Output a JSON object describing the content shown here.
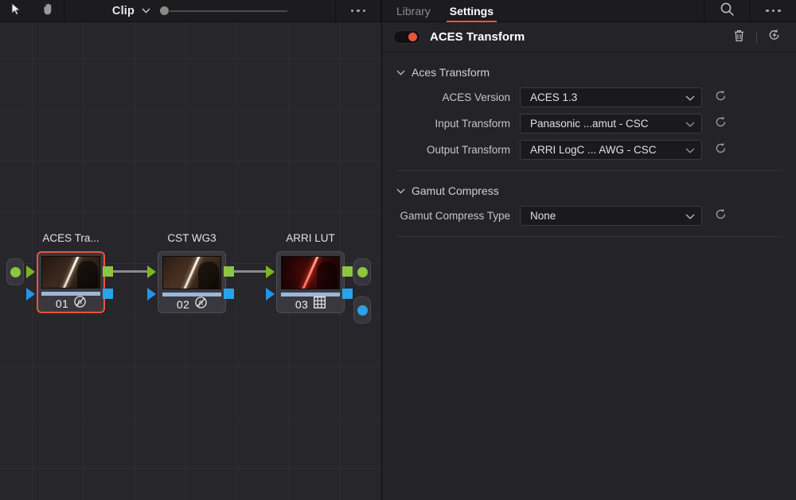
{
  "node_toolbar": {
    "tools": [
      {
        "name": "select-tool",
        "icon": "arrow-cursor-icon"
      },
      {
        "name": "pan-tool",
        "icon": "hand-icon"
      }
    ],
    "clip_label": "Clip",
    "chevron_icon": "chevron-down-icon",
    "slider_value": 0,
    "overflow_icon": "ellipsis-icon"
  },
  "node_graph": {
    "input_connector": {
      "name": "graph-input-source",
      "color": "#8cc63f"
    },
    "output_connectors": [
      {
        "name": "graph-output-rgb",
        "color": "#8cc63f"
      },
      {
        "name": "graph-output-key",
        "color": "#2aa3e8"
      }
    ],
    "nodes": [
      {
        "title": "ACES Tra...",
        "number": "01",
        "badge_icon": "fx-icon",
        "selected": true,
        "thumb_streak": "#d8c9b4",
        "thumb_bg": "#2a1d16"
      },
      {
        "title": "CST WG3",
        "number": "02",
        "badge_icon": "fx-icon",
        "selected": false,
        "thumb_streak": "#e7d7bf",
        "thumb_bg": "#32201a"
      },
      {
        "title": "ARRI LUT",
        "number": "03",
        "badge_icon": "lut-grid-icon",
        "selected": false,
        "thumb_streak": "#ff6a58",
        "thumb_bg": "#2e0707"
      }
    ]
  },
  "inspector": {
    "tabs": [
      {
        "label": "Library",
        "active": false
      },
      {
        "label": "Settings",
        "active": true
      }
    ],
    "search_icon": "search-icon",
    "overflow_icon": "ellipsis-icon",
    "effect": {
      "enabled": true,
      "accent_color": "#e8553d",
      "title": "ACES Transform",
      "delete_icon": "trash-icon",
      "reset_all_icon": "reset-add-icon"
    },
    "sections": [
      {
        "title": "Aces Transform",
        "collapse_icon": "chevron-down-icon",
        "rows": [
          {
            "label": "ACES Version",
            "value": "ACES 1.3",
            "reset_icon": "reset-icon"
          },
          {
            "label": "Input Transform",
            "value": "Panasonic ...amut - CSC",
            "reset_icon": "reset-icon"
          },
          {
            "label": "Output Transform",
            "value": "ARRI LogC ... AWG - CSC",
            "reset_icon": "reset-icon"
          }
        ]
      },
      {
        "title": "Gamut Compress",
        "collapse_icon": "chevron-down-icon",
        "rows": [
          {
            "label": "Gamut Compress Type",
            "value": "None",
            "reset_icon": "reset-icon"
          }
        ]
      }
    ]
  }
}
